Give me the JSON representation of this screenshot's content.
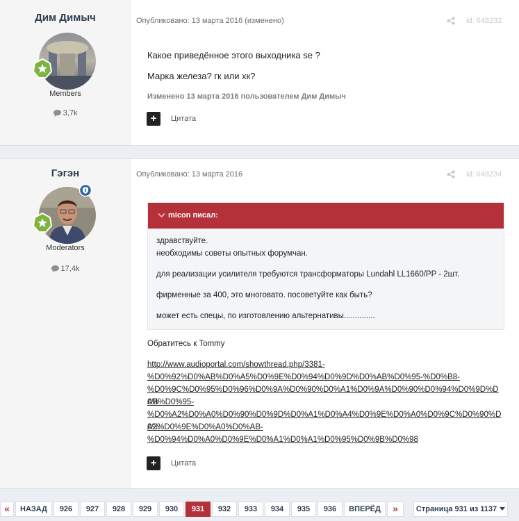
{
  "posts": [
    {
      "author": "Дим Димыч",
      "group": "Members",
      "reputation": "3,7k",
      "meta": "Опубликовано: 13 марта 2016 (изменено)",
      "id": "id: 648232",
      "lines": [
        "Какое приведённое этого выходника se ?",
        "Марка железа? гк или хк?"
      ],
      "edited": "Изменено 13 марта 2016 пользователем Дим Димыч",
      "quote_label": "Цитата"
    },
    {
      "author": "Гэгэн",
      "group": "Moderators",
      "reputation": "17,4k",
      "meta": "Опубликовано: 13 марта 2016",
      "id": "id: 648234",
      "quote_header": "micon писал:",
      "quote_lines": [
        "здравствуйте.",
        "необходимы советы опытных форумчан.",
        "для реализации усилителя требуются трансформаторы Lundahl LL1660/PP - 2шт.",
        "фирменные за 400, это многовато. посоветуйте как быть?",
        "может есть спецы, по изготовлению альтернативы.............."
      ],
      "reply": "Обратитесь к Tommy",
      "link_lines": [
        "http://www.audioportal.com/showthread.php/3381-",
        "%D0%92%D0%AB%D0%A5%D0%9E%D0%94%D0%9D%D0%AB%D0%95-%D0%B8-",
        "%D0%9C%D0%95%D0%96%D0%9A%D0%90%D0%A1%D0%9A%D0%90%D0%94%D0%9D%D0%",
        "AB%D0%95-",
        "%D0%A2%D0%A0%D0%90%D0%9D%D0%A1%D0%A4%D0%9E%D0%A0%D0%9C%D0%90%D0%",
        "A2%D0%9E%D0%A0%D0%AB-",
        "%D0%94%D0%A0%D0%9E%D0%A1%D0%A1%D0%95%D0%9B%D0%98"
      ],
      "quote_label": "Цитата"
    }
  ],
  "pagination": {
    "first": "«",
    "prev": "НАЗАД",
    "pages": [
      "926",
      "927",
      "928",
      "929",
      "930",
      "931",
      "932",
      "933",
      "934",
      "935",
      "936"
    ],
    "active": "931",
    "next": "ВПЕРЁД",
    "last": "»",
    "jump": "Страница 931 из 1137"
  },
  "colors": {
    "accent": "#b5313a",
    "name": "#2b3e50",
    "badge_green": "#7fb33f"
  }
}
